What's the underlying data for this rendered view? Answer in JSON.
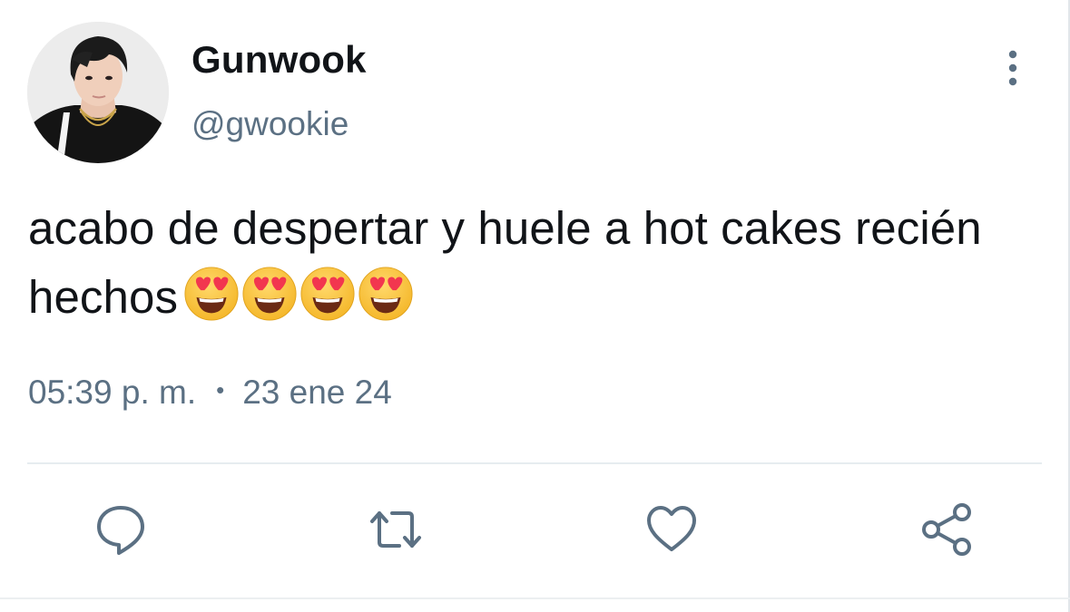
{
  "tweet": {
    "display_name": "Gunwook",
    "handle": "@gwookie",
    "text": "acabo de despertar y huele a hot cakes recién hechos",
    "emojis": [
      "smiling-face-with-heart-eyes",
      "smiling-face-with-heart-eyes",
      "smiling-face-with-heart-eyes",
      "smiling-face-with-heart-eyes"
    ],
    "time": "05:39 p. m.",
    "separator": "•",
    "date": "23 ene 24"
  },
  "actions": [
    {
      "name": "reply",
      "icon": "speech-bubble-icon"
    },
    {
      "name": "retweet",
      "icon": "retweet-icon"
    },
    {
      "name": "like",
      "icon": "heart-icon"
    },
    {
      "name": "share",
      "icon": "share-icon"
    }
  ],
  "colors": {
    "text_primary": "#111418",
    "text_secondary": "#5b7083",
    "icon": "#5b7083",
    "divider": "#e6ecf0"
  }
}
